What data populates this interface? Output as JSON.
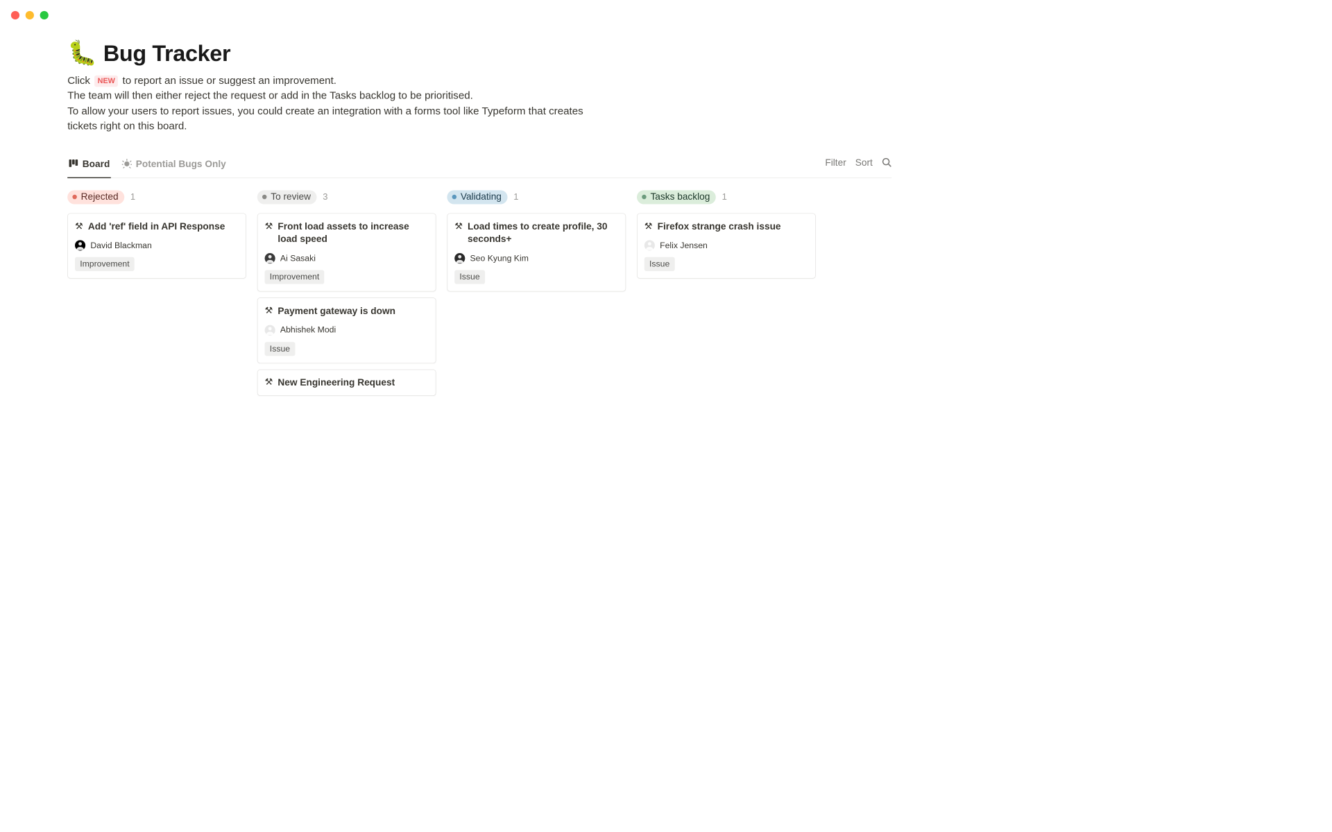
{
  "header": {
    "emoji": "🐛",
    "title": "Bug Tracker"
  },
  "description": {
    "line1_pre": "Click",
    "new_badge": "NEW",
    "line1_post": "to report an issue or suggest an improvement.",
    "line2": "The team will then either reject the request or add in the Tasks backlog to be prioritised.",
    "line3": "To allow your users to report issues, you could create an integration with a forms tool like Typeform that creates tickets right on this board."
  },
  "views": {
    "tabs": [
      {
        "label": "Board",
        "active": true
      },
      {
        "label": "Potential Bugs Only",
        "active": false
      }
    ],
    "actions": {
      "filter": "Filter",
      "sort": "Sort"
    }
  },
  "columns": [
    {
      "name": "Rejected",
      "count": "1",
      "pill_bg": "#ffe2dd",
      "pill_fg": "#5a2b25",
      "dot": "#e06a5c",
      "cards": [
        {
          "title": "Add 'ref' field in API Response",
          "person": "David Blackman",
          "tag": "Improvement",
          "avatar_bg": "#000000"
        }
      ]
    },
    {
      "name": "To review",
      "count": "3",
      "pill_bg": "#efefee",
      "pill_fg": "#4a4a47",
      "dot": "#8a8a86",
      "cards": [
        {
          "title": "Front load assets to increase load speed",
          "person": "Ai Sasaki",
          "tag": "Improvement",
          "avatar_bg": "#3a3a3a"
        },
        {
          "title": "Payment gateway is down",
          "person": "Abhishek Modi",
          "tag": "Issue",
          "avatar_bg": "#e8e8e8"
        },
        {
          "title": "New Engineering Request",
          "simple": true
        }
      ]
    },
    {
      "name": "Validating",
      "count": "1",
      "pill_bg": "#d3e5ef",
      "pill_fg": "#1b3a4b",
      "dot": "#5b97bd",
      "cards": [
        {
          "title": "Load times to create profile, 30 seconds+",
          "person": "Seo Kyung Kim",
          "tag": "Issue",
          "avatar_bg": "#2a2a2a"
        }
      ]
    },
    {
      "name": "Tasks backlog",
      "count": "1",
      "pill_bg": "#dbeddb",
      "pill_fg": "#1c3829",
      "dot": "#6c9b7d",
      "cards": [
        {
          "title": "Firefox strange crash issue",
          "person": "Felix Jensen",
          "tag": "Issue",
          "avatar_bg": "#e8e8e8"
        }
      ]
    }
  ]
}
